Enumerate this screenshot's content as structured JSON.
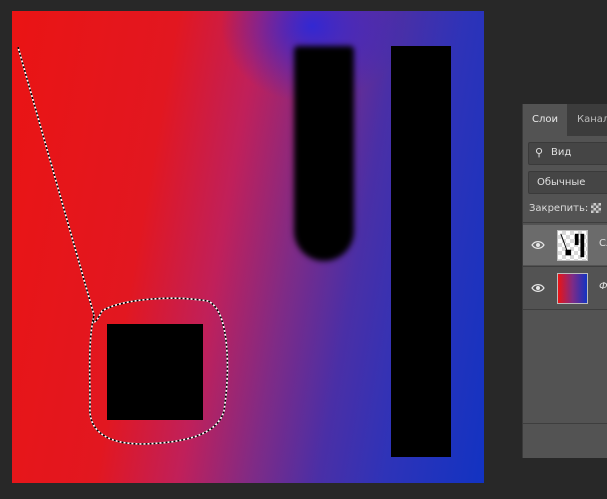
{
  "layers_panel": {
    "tab_layers": "Слои",
    "tab_channels": "Канал",
    "search_kind": "Вид",
    "blend_mode": "Обычные",
    "lock_label": "Закрепить:",
    "layers": [
      {
        "name": "Сл",
        "thumb": "transparent-with-shapes",
        "selected": true,
        "visible": true
      },
      {
        "name": "Ф",
        "thumb": "red-blue-gradient",
        "selected": false,
        "visible": true
      }
    ]
  },
  "colors": {
    "gradient_left": "#ea1414",
    "gradient_right": "#1233c2",
    "shape_fill": "#000000",
    "panel_bg": "#535353"
  },
  "icons": [
    "search-icon",
    "eye-icon",
    "lock-transparent-icon"
  ]
}
